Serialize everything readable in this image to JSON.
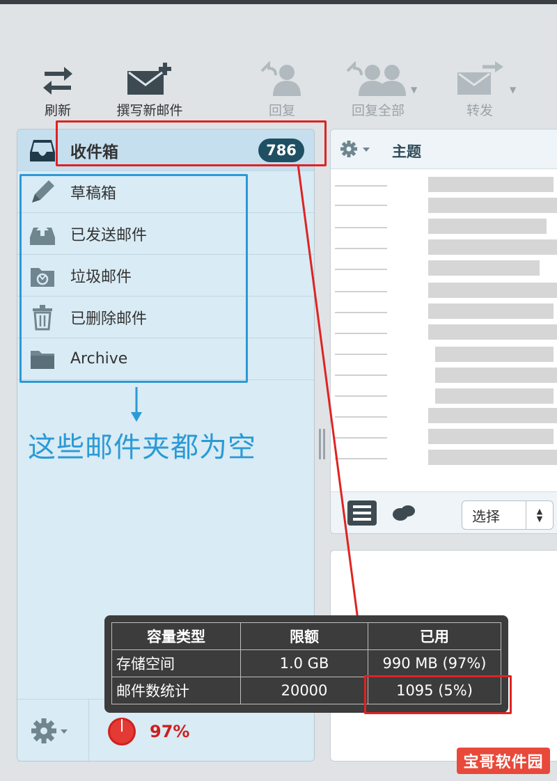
{
  "toolbar": {
    "refresh": "刷新",
    "compose": "撰写新邮件",
    "reply": "回复",
    "reply_all": "回复全部",
    "forward": "转发"
  },
  "folders": [
    {
      "name": "收件箱",
      "icon": "inbox-icon",
      "count": "786"
    },
    {
      "name": "草稿箱",
      "icon": "pencil-icon"
    },
    {
      "name": "已发送邮件",
      "icon": "sent-icon"
    },
    {
      "name": "垃圾邮件",
      "icon": "junk-icon"
    },
    {
      "name": "已删除邮件",
      "icon": "trash-icon"
    },
    {
      "name": "Archive",
      "icon": "folder-icon"
    }
  ],
  "annotation": {
    "caption": "这些邮件夹都为空"
  },
  "message_list": {
    "subject_header": "主题",
    "select_label": "选择"
  },
  "quota": {
    "percent": "97%",
    "level": 0.97,
    "table": {
      "headers": [
        "容量类型",
        "限额",
        "已用"
      ],
      "rows": [
        [
          "存储空间",
          "1.0 GB",
          "990 MB (97%)"
        ],
        [
          "邮件数统计",
          "20000",
          "1095 (5%)"
        ]
      ]
    }
  },
  "watermark": "宝哥软件园",
  "colors": {
    "badge": "#1f4f63",
    "annotation_red": "#e02222",
    "annotation_blue": "#2b9ad6",
    "quota_red": "#cc1f1f"
  }
}
